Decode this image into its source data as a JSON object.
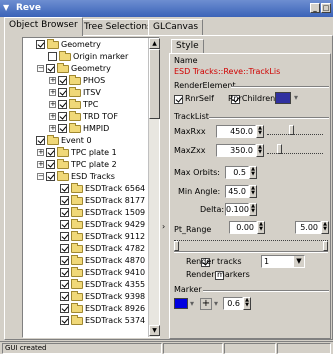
{
  "window": {
    "title": "Reve",
    "buttons": [
      "_",
      "□"
    ]
  },
  "tabs": [
    {
      "label": "Object Browser",
      "active": true
    },
    {
      "label": "Tree Selections",
      "active": false
    },
    {
      "label": "GLCanvas",
      "active": false
    }
  ],
  "tree": {
    "items": [
      {
        "label": "Geometry",
        "indent": 0,
        "expander": "",
        "checked": true
      },
      {
        "label": "Origin marker",
        "indent": 1,
        "expander": "",
        "checked": false
      },
      {
        "label": "Geometry",
        "indent": 1,
        "expander": "−",
        "checked": true
      },
      {
        "label": "PHOS",
        "indent": 2,
        "expander": "+",
        "checked": true
      },
      {
        "label": "ITSV",
        "indent": 2,
        "expander": "+",
        "checked": true
      },
      {
        "label": "TPC",
        "indent": 2,
        "expander": "+",
        "checked": true
      },
      {
        "label": "TRD TOF",
        "indent": 2,
        "expander": "+",
        "checked": true
      },
      {
        "label": "HMPID",
        "indent": 2,
        "expander": "+",
        "checked": true
      },
      {
        "label": "Event 0",
        "indent": 0,
        "expander": "",
        "checked": true
      },
      {
        "label": "TPC plate 1",
        "indent": 1,
        "expander": "+",
        "checked": true
      },
      {
        "label": "TPC plate 2",
        "indent": 1,
        "expander": "+",
        "checked": true
      },
      {
        "label": "ESD Tracks",
        "indent": 1,
        "expander": "−",
        "checked": true
      },
      {
        "label": "ESDTrack 6564",
        "indent": 2,
        "expander": "",
        "checked": true
      },
      {
        "label": "ESDTrack 8177",
        "indent": 2,
        "expander": "",
        "checked": true
      },
      {
        "label": "ESDTrack 1509",
        "indent": 2,
        "expander": "",
        "checked": true
      },
      {
        "label": "ESDTrack 9429",
        "indent": 2,
        "expander": "",
        "checked": true
      },
      {
        "label": "ESDTrack 9112",
        "indent": 2,
        "expander": "",
        "checked": true
      },
      {
        "label": "ESDTrack 4782",
        "indent": 2,
        "expander": "",
        "checked": true
      },
      {
        "label": "ESDTrack 4870",
        "indent": 2,
        "expander": "",
        "checked": true
      },
      {
        "label": "ESDTrack 9410",
        "indent": 2,
        "expander": "",
        "checked": true
      },
      {
        "label": "ESDTrack 4355",
        "indent": 2,
        "expander": "",
        "checked": true
      },
      {
        "label": "ESDTrack 9398",
        "indent": 2,
        "expander": "",
        "checked": true
      },
      {
        "label": "ESDTrack 8926",
        "indent": 2,
        "expander": "",
        "checked": true
      },
      {
        "label": "ESDTrack 5374",
        "indent": 2,
        "expander": "",
        "checked": true
      }
    ]
  },
  "editor": {
    "style_tab": "Style",
    "name_label": "Name",
    "name_value": "ESD Tracks::Reve::TrackLis",
    "render_element_label": "RenderElement",
    "rnr_self_label": "RnrSelf",
    "rnr_children_label": "RnrChildren",
    "tracklist_label": "TrackList",
    "max_rxx_label": "MaxRxx",
    "max_rxx_value": "450.0",
    "max_zxx_label": "MaxZxx",
    "max_zxx_value": "350.0",
    "max_orbits_label": "Max Orbits:",
    "max_orbits_value": "0.5",
    "min_angle_label": "Min Angle:",
    "min_angle_value": "45.0",
    "delta_label": "Delta:",
    "delta_value": "0.100",
    "pt_range_label": "Pt_Range",
    "pt_min_value": "0.00",
    "pt_max_value": "5.00",
    "render_tracks_label": "Render tracks",
    "render_tracks_select": "1",
    "render_markers_label": "Render markers",
    "marker_label": "Marker",
    "marker_size_value": "0.6",
    "color_swatch": "#3030a0",
    "marker_color": "#0000e0"
  },
  "statusbar": {
    "text": "GUI created"
  }
}
